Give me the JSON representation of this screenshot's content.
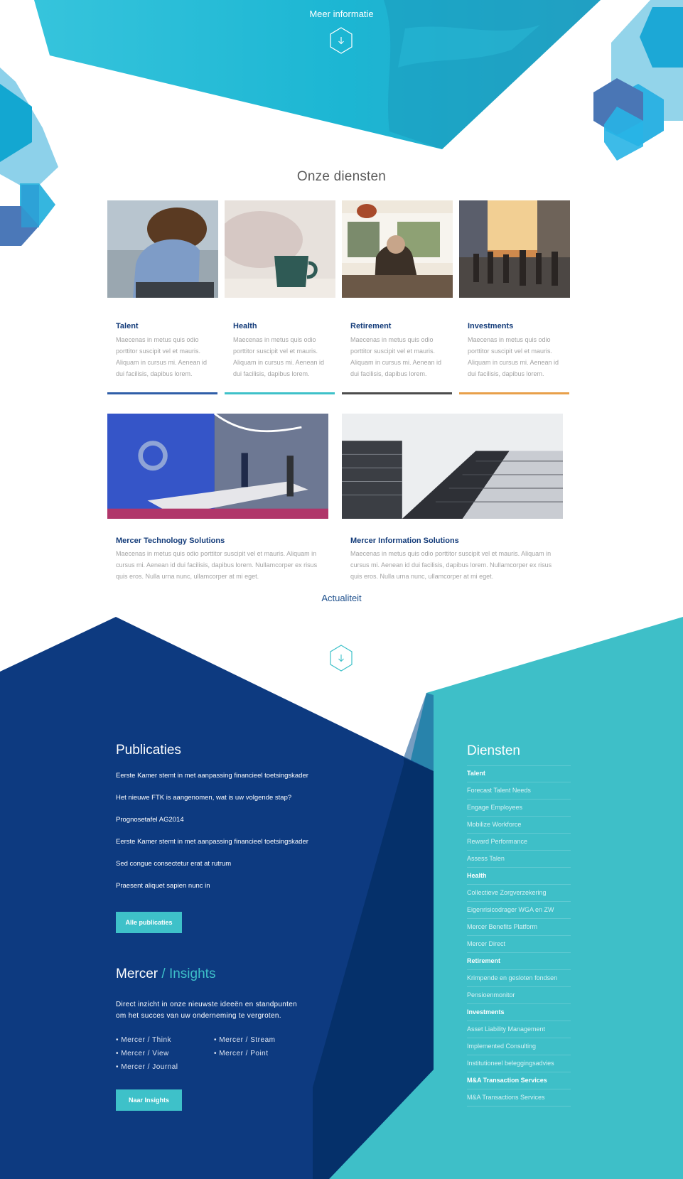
{
  "hero": {
    "more_info": "Meer informatie"
  },
  "services": {
    "title": "Onze diensten",
    "cards": [
      {
        "name": "Talent",
        "text": "Maecenas in metus quis odio porttitor suscipit vel et mauris. Aliquam in cursus mi. Aenean id dui facilisis, dapibus lorem.",
        "accent": "#2f5ea8"
      },
      {
        "name": "Health",
        "text": "Maecenas in metus quis odio porttitor suscipit vel et mauris. Aliquam in cursus mi. Aenean id dui facilisis, dapibus lorem.",
        "accent": "#3ec1c9"
      },
      {
        "name": "Retirement",
        "text": "Maecenas in metus quis odio porttitor suscipit vel et mauris. Aliquam in cursus mi. Aenean id dui facilisis, dapibus lorem.",
        "accent": "#4c4c4c"
      },
      {
        "name": "Investments",
        "text": "Maecenas in metus quis odio porttitor suscipit vel et mauris. Aliquam in cursus mi. Aenean id dui facilisis, dapibus lorem.",
        "accent": "#e8a04a"
      }
    ],
    "solutions": [
      {
        "name": "Mercer Technology Solutions",
        "text": "Maecenas in metus quis odio porttitor suscipit vel et mauris. Aliquam in cursus mi. Aenean id dui facilisis, dapibus lorem. Nullamcorper ex risus quis eros. Nulla urna nunc, ullamcorper at mi eget."
      },
      {
        "name": "Mercer Information Solutions",
        "text": "Maecenas in metus quis odio porttitor suscipit vel et mauris. Aliquam in cursus mi. Aenean id dui facilisis, dapibus lorem. Nullamcorper ex risus quis eros. Nulla urna nunc, ullamcorper at mi eget."
      }
    ]
  },
  "actualiteit": {
    "title": "Actualiteit"
  },
  "publicaties": {
    "title": "Publicaties",
    "items": [
      "Eerste Kamer stemt in met aanpassing financieel toetsingskader",
      "Het nieuwe FTK is aangenomen, wat is uw volgende stap?",
      "Prognosetafel AG2014",
      "Eerste Kamer stemt in met aanpassing financieel toetsingskader",
      "Sed congue consectetur erat at rutrum",
      "Praesent aliquet sapien nunc in"
    ],
    "button": "Alle publicaties"
  },
  "insights": {
    "title_main": "Mercer",
    "title_accent": "/ Insights",
    "description": "Direct inzicht in onze nieuwste ideeën en standpunten om het succes van uw onderneming te vergroten.",
    "links_col1": [
      "• Mercer / Think",
      "• Mercer / View",
      "• Mercer / Journal"
    ],
    "links_col2": [
      "• Mercer / Stream",
      "• Mercer / Point"
    ],
    "button": "Naar Insights"
  },
  "diensten": {
    "title": "Diensten",
    "items": [
      {
        "label": "Talent",
        "header": true
      },
      {
        "label": "Forecast Talent Needs",
        "header": false
      },
      {
        "label": "Engage Employees",
        "header": false
      },
      {
        "label": "Mobilize Workforce",
        "header": false
      },
      {
        "label": "Reward Performance",
        "header": false
      },
      {
        "label": "Assess Talen",
        "header": false
      },
      {
        "label": "Health",
        "header": true
      },
      {
        "label": "Collectieve Zorgverzekering",
        "header": false
      },
      {
        "label": "Eigenrisicodrager WGA en ZW",
        "header": false
      },
      {
        "label": "Mercer Benefits Platform",
        "header": false
      },
      {
        "label": "Mercer Direct",
        "header": false
      },
      {
        "label": "Retirement",
        "header": true
      },
      {
        "label": "Krimpende en gesloten fondsen",
        "header": false
      },
      {
        "label": "Pensioenmonitor",
        "header": false
      },
      {
        "label": "Investments",
        "header": true
      },
      {
        "label": "Asset Liability Management",
        "header": false
      },
      {
        "label": "Implemented Consulting",
        "header": false
      },
      {
        "label": "Institutioneel beleggingsadvies",
        "header": false
      },
      {
        "label": "M&A Transaction Services",
        "header": true
      },
      {
        "label": "M&A Transactions Services",
        "header": false
      }
    ]
  },
  "colors": {
    "navy": "#0d3a80",
    "navy_dark": "#062f66",
    "teal": "#3ec1c9",
    "hero_cyan": "#1bb7d3"
  },
  "icons": [
    "arrow-down-hex-icon"
  ]
}
